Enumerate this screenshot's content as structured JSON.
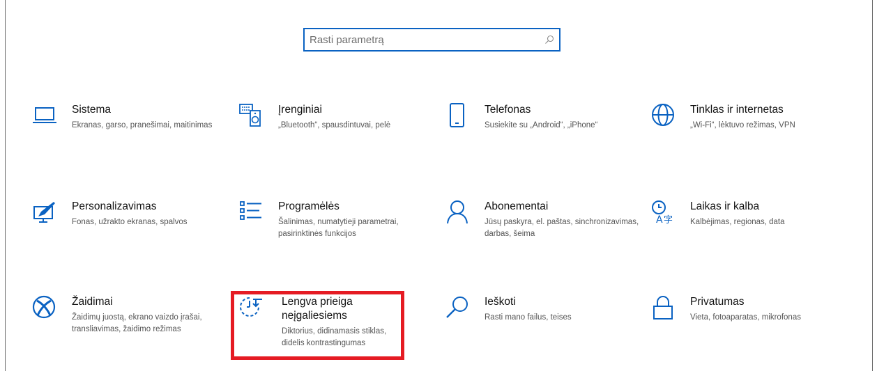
{
  "search": {
    "placeholder": "Rasti parametrą"
  },
  "colors": {
    "accent": "#0a62c2",
    "highlight": "#e51b23"
  },
  "tiles": [
    {
      "title": "Sistema",
      "desc": "Ekranas, garso, pranešimai, maitinimas",
      "icon": "laptop-icon"
    },
    {
      "title": "Įrenginiai",
      "desc": "„Bluetooth“, spausdintuvai, pelė",
      "icon": "devices-icon"
    },
    {
      "title": "Telefonas",
      "desc": "Susiekite su „Android“, „iPhone“",
      "icon": "phone-icon"
    },
    {
      "title": "Tinklas ir internetas",
      "desc": "„Wi-Fi“, lėktuvo režimas, VPN",
      "icon": "globe-icon"
    },
    {
      "title": "Personalizavimas",
      "desc": "Fonas, užrakto ekranas, spalvos",
      "icon": "personalization-icon"
    },
    {
      "title": "Programėlės",
      "desc": "Šalinimas, numatytieji parametrai, pasirinktinės funkcijos",
      "icon": "apps-list-icon"
    },
    {
      "title": "Abonementai",
      "desc": "Jūsų paskyra, el. paštas, sinchronizavimas, darbas, šeima",
      "icon": "person-icon"
    },
    {
      "title": "Laikas ir kalba",
      "desc": "Kalbėjimas, regionas, data",
      "icon": "time-language-icon"
    },
    {
      "title": "Žaidimai",
      "desc": "Žaidimų juostą, ekrano vaizdo įrašai, transliavimas, žaidimo režimas",
      "icon": "xbox-icon"
    },
    {
      "title": "Lengva prieiga neįgaliesiems",
      "desc": "Diktorius, didinamasis stiklas, didelis kontrastingumas",
      "icon": "ease-of-access-icon"
    },
    {
      "title": "Ieškoti",
      "desc": "Rasti mano failus, teises",
      "icon": "search-icon"
    },
    {
      "title": "Privatumas",
      "desc": "Vieta, fotoaparatas, mikrofonas",
      "icon": "lock-icon"
    }
  ]
}
